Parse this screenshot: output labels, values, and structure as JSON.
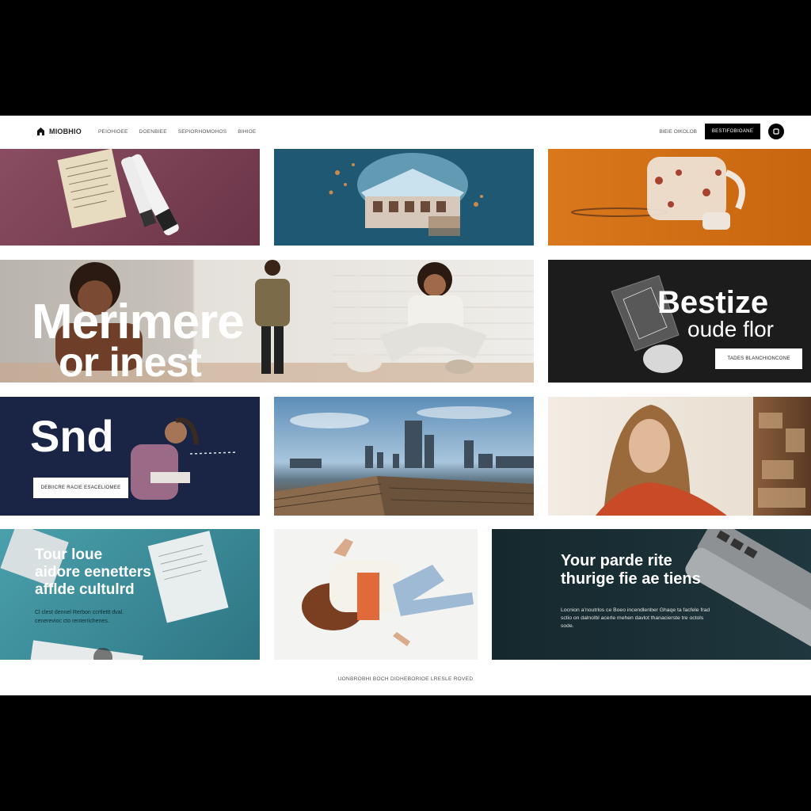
{
  "brand": {
    "name": "MIOBHIO",
    "icon": "home-icon"
  },
  "nav": {
    "links": [
      "PEIOHIOEE",
      "DOENBIEE",
      "SEPIORHOMOHOS",
      "BIHIOE"
    ],
    "small_text": "BIEIE OIKOLOB",
    "cta_label": "BESTIFOBIOANE",
    "circle_icon": "square-icon"
  },
  "hero": {
    "line1": "Merimere",
    "line2": "or inest"
  },
  "promo_dark": {
    "line1": "Bestize",
    "line2": "oude flor",
    "button_label": "TADES BLANCHIONCONE"
  },
  "promo_navy": {
    "title": "Snd",
    "button_label": "DEBIICRE RACIE ESACELIOMEE"
  },
  "teal_card": {
    "headline_lines": [
      "Tour loue",
      "aidore eenetters",
      "afflde cultulrd"
    ],
    "body_lines": [
      "Cl clest dennel Rerbon ccrtlettt dval.",
      "cenerevioc cto renterrichenes."
    ]
  },
  "dark_card": {
    "headline_lines": [
      "Your parde rite",
      "thurige fie ae tiens"
    ],
    "body_lines": [
      "Locnion a’noutrlos ce Boeo incendlenber Ghaqe ta facfele frad",
      "sctio on dalnolbl acerle mehen davlot thanacierste tre octols",
      "sode."
    ]
  },
  "footer": {
    "text": "UONBROBHI BOCH DIDHEBORIOE LRESLE ROVED"
  },
  "colors": {
    "page_bg": "#ffffff",
    "outer_bg": "#000000",
    "cta_bg": "#000000",
    "plum": "#7a4255",
    "teal_blue": "#1e5872",
    "orange": "#d6761b",
    "navy": "#1a2545",
    "charcoal": "#1c1c1c",
    "teal": "#3a8795",
    "slate": "#1d3239"
  }
}
